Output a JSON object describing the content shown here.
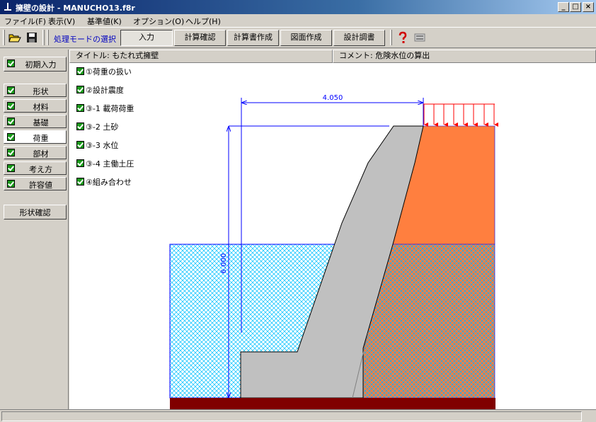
{
  "window": {
    "title": "擁壁の設計 - MANUCHO13.f8r"
  },
  "menu": [
    {
      "label": "ファイル(F)"
    },
    {
      "label": "表示(V)"
    },
    {
      "label": "基準値(K)"
    },
    {
      "label": "オプション(O)"
    },
    {
      "label": "ヘルプ(H)"
    }
  ],
  "toolbar": {
    "mode_label": "処理モードの選択",
    "modes": [
      {
        "label": "入力",
        "active": true
      },
      {
        "label": "計算確認"
      },
      {
        "label": "計算書作成"
      },
      {
        "label": "図面作成"
      },
      {
        "label": "設計調書"
      }
    ]
  },
  "sidebar": {
    "items": [
      {
        "label": "初期入力"
      },
      {
        "label": "形状"
      },
      {
        "label": "材料"
      },
      {
        "label": "基礎"
      },
      {
        "label": "荷重",
        "selected": true
      },
      {
        "label": "部材"
      },
      {
        "label": "考え方"
      },
      {
        "label": "許容値"
      }
    ],
    "shape_check": "形状確認"
  },
  "header": {
    "title": "タイトル: もたれ式擁壁",
    "comment": "コメント: 危険水位の算出"
  },
  "load_items": [
    {
      "label": "①荷重の扱い"
    },
    {
      "label": "②設計震度"
    },
    {
      "label": "③-1 載荷荷重"
    },
    {
      "label": "③-2 土砂"
    },
    {
      "label": "③-3 水位"
    },
    {
      "label": "③-4 主働土圧"
    },
    {
      "label": "④組み合わせ"
    }
  ],
  "drawing": {
    "width_dim": "4.050",
    "height_dim": "6.000",
    "colors": {
      "wall": "#c0c0c0",
      "soil": "#ff7f3f",
      "water": "#00c0ff",
      "dim": "#0000ff",
      "load": "#ff0000",
      "base": "#800000"
    }
  }
}
